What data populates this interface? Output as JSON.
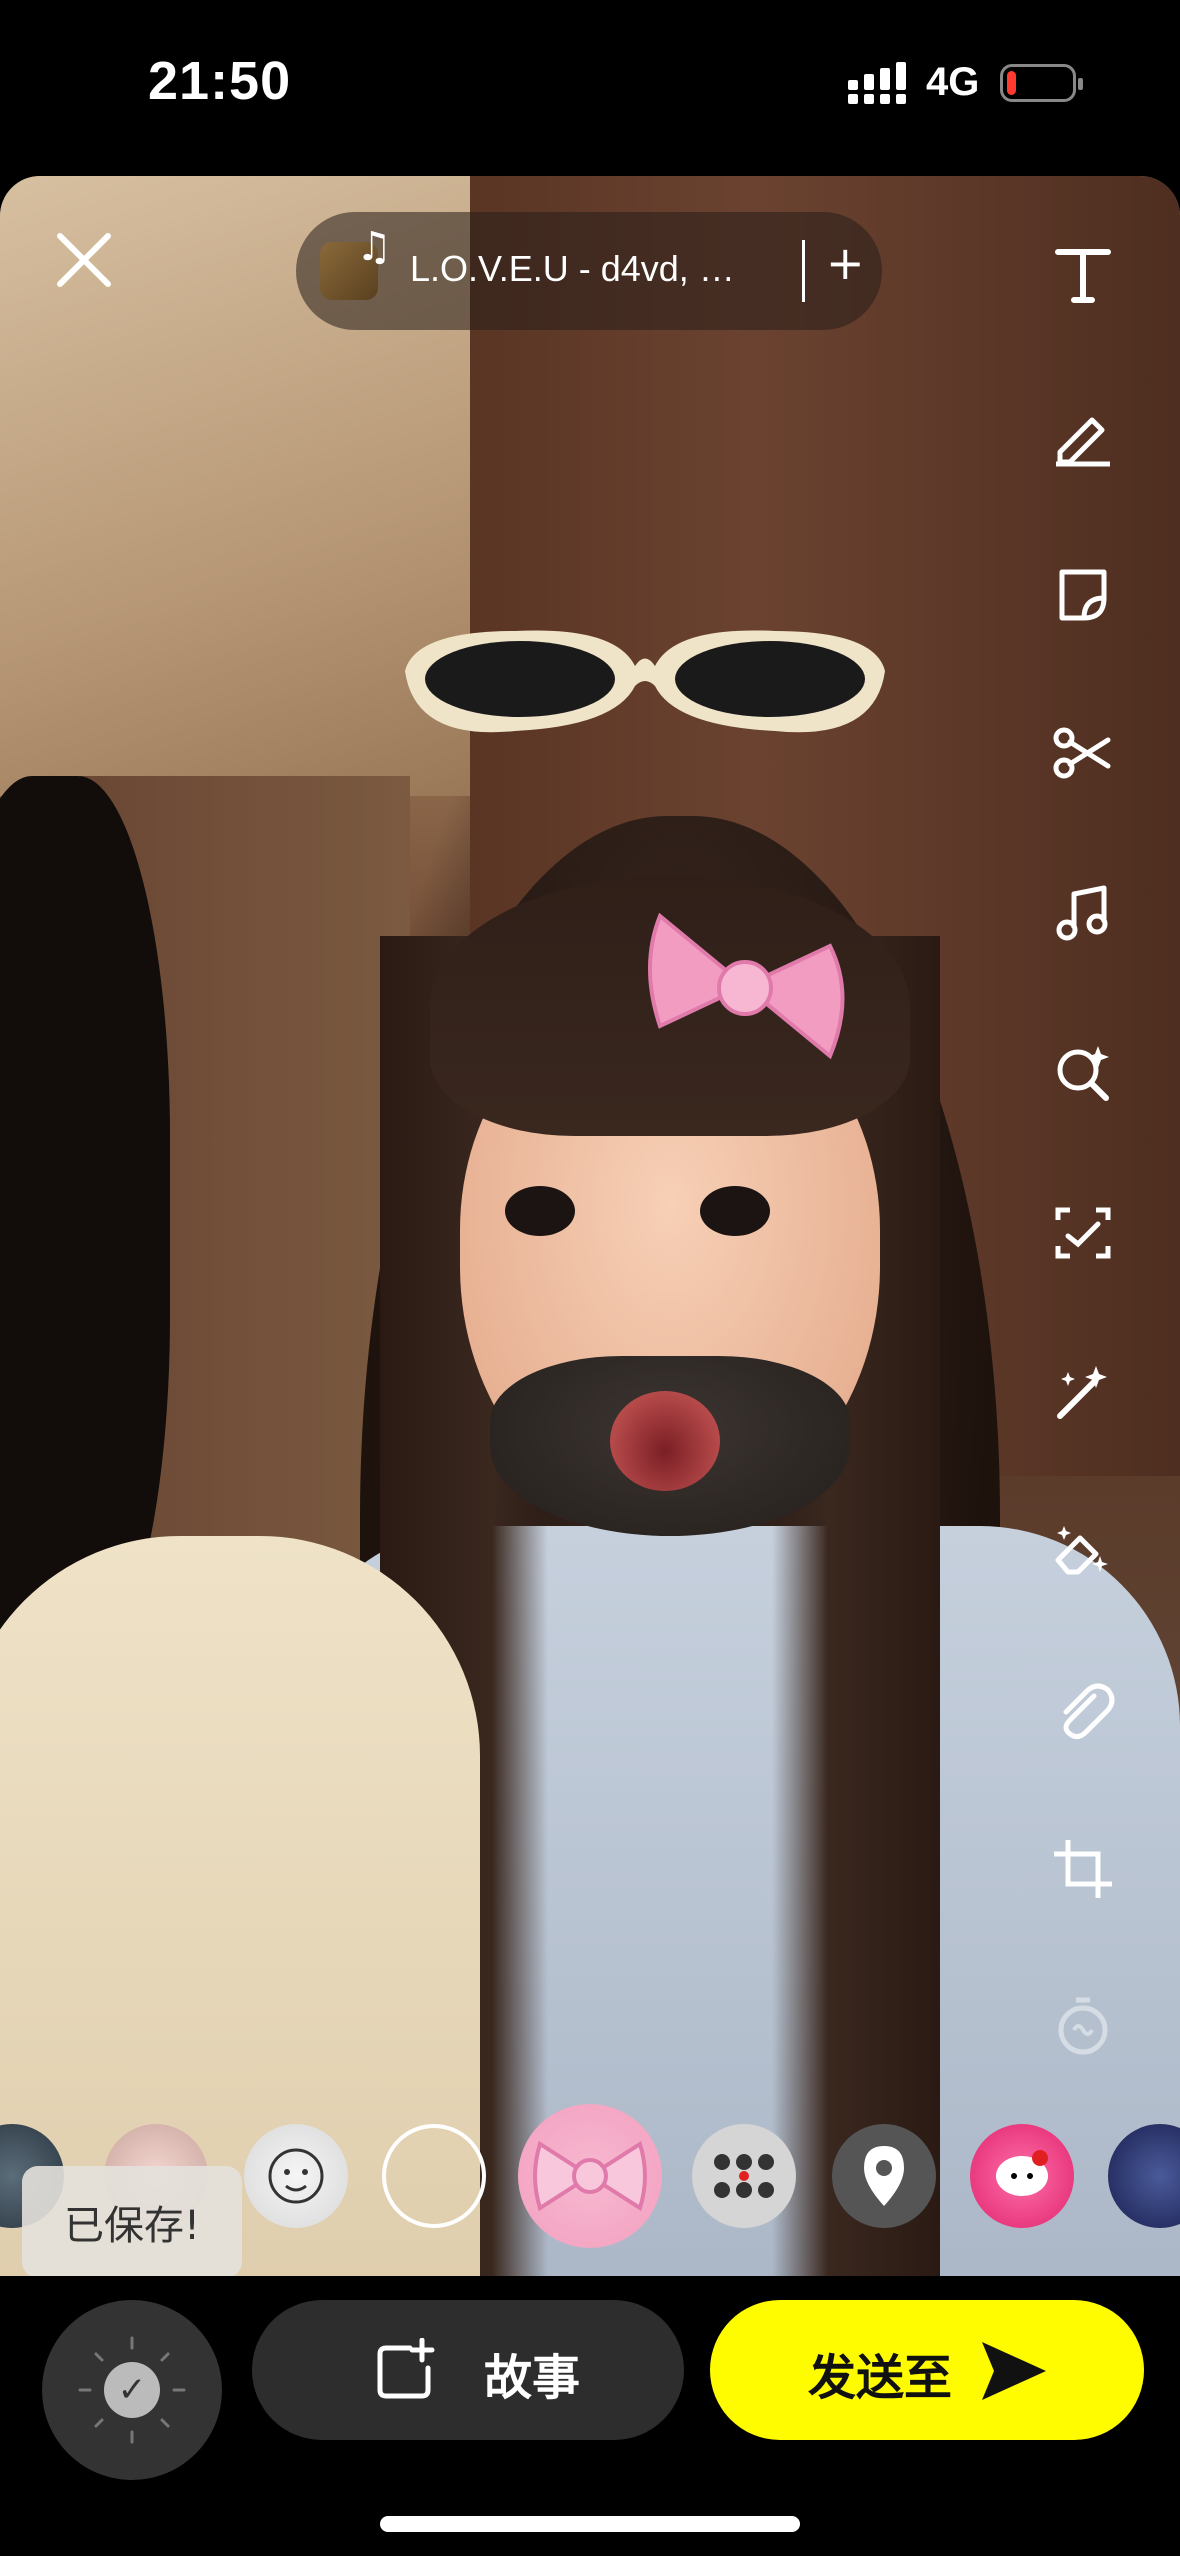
{
  "status_bar": {
    "time": "21:50",
    "network": "4G",
    "battery_level": 0.15,
    "battery_color": "#ff3b30"
  },
  "top_bar": {
    "close_icon": "close-icon",
    "music": {
      "title": "L.O.V.E.U - d4vd, ha...",
      "add_label": "+"
    }
  },
  "toolbar": [
    {
      "name": "text-tool",
      "icon": "text-icon"
    },
    {
      "name": "draw-tool",
      "icon": "pencil-icon"
    },
    {
      "name": "sticker-tool",
      "icon": "sticker-icon"
    },
    {
      "name": "cut-tool",
      "icon": "scissors-icon"
    },
    {
      "name": "music-tool",
      "icon": "music-note-icon"
    },
    {
      "name": "lens-search-tool",
      "icon": "magnify-sparkle-icon"
    },
    {
      "name": "scan-tool",
      "icon": "scan-face-icon"
    },
    {
      "name": "magic-tool",
      "icon": "magic-wand-icon"
    },
    {
      "name": "eraser-tool",
      "icon": "magic-eraser-icon"
    },
    {
      "name": "attach-tool",
      "icon": "paperclip-icon"
    },
    {
      "name": "crop-tool",
      "icon": "crop-icon"
    },
    {
      "name": "timer-tool",
      "icon": "timer-loop-icon"
    }
  ],
  "lenses": {
    "saved_tooltip": "已保存!",
    "selected": "bow-lens",
    "bow_color": "#f29cc2"
  },
  "bottom_bar": {
    "story_label": "故事",
    "send_label": "发送至",
    "send_color": "#fffc00"
  }
}
